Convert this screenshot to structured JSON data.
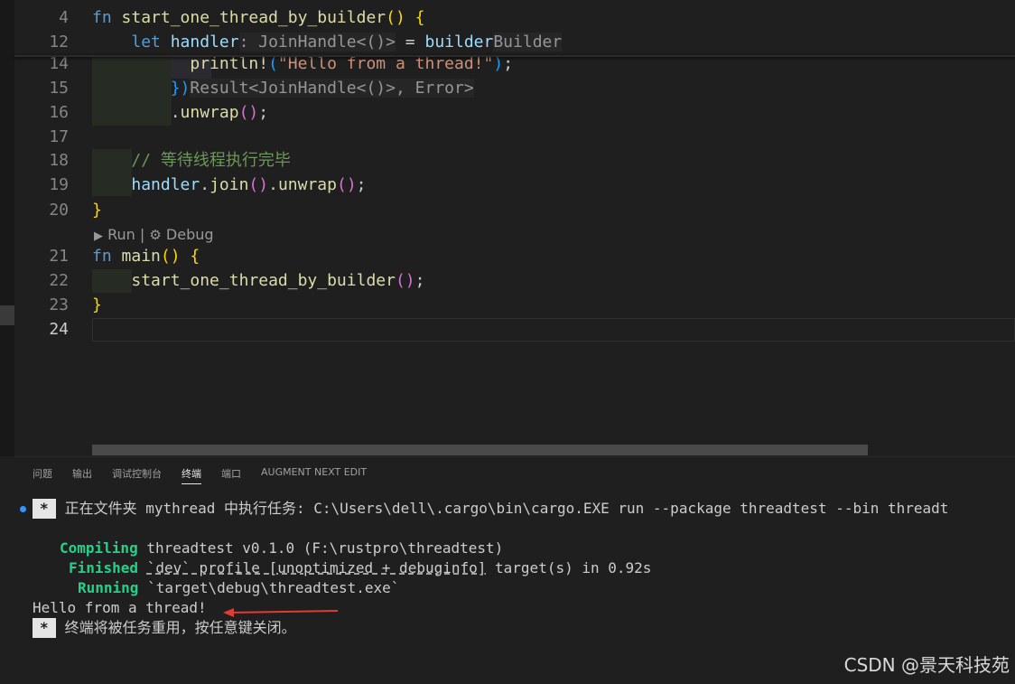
{
  "editor": {
    "lines": [
      {
        "n": "4",
        "segments": [
          [
            "kw",
            "fn "
          ],
          [
            "fn",
            "start_one_thread_by_builder"
          ],
          [
            "br1",
            "() {"
          ]
        ]
      },
      {
        "n": "12",
        "segments": [
          [
            "plain",
            "    "
          ],
          [
            "kw",
            "let "
          ],
          [
            "var",
            "handler"
          ],
          [
            "hint",
            ": JoinHandle<()>"
          ],
          [
            "plain",
            " = "
          ],
          [
            "var",
            "builder"
          ],
          [
            "hint",
            "Builder"
          ]
        ]
      },
      {
        "n": "14",
        "segments": [
          [
            "plain",
            "          "
          ],
          [
            "fn",
            "println!"
          ],
          [
            "br3",
            "("
          ],
          [
            "str",
            "\"Hello from a thread!\""
          ],
          [
            "br3",
            ")"
          ],
          [
            "plain",
            ";"
          ]
        ]
      },
      {
        "n": "15",
        "segments": [
          [
            "plain",
            "        "
          ],
          [
            "br3",
            "})"
          ],
          [
            "hint",
            "Result<JoinHandle<()>, Error>"
          ]
        ]
      },
      {
        "n": "16",
        "segments": [
          [
            "plain",
            "        ."
          ],
          [
            "fn",
            "unwrap"
          ],
          [
            "br2",
            "()"
          ],
          [
            "plain",
            ";"
          ]
        ]
      },
      {
        "n": "17",
        "segments": []
      },
      {
        "n": "18",
        "segments": [
          [
            "plain",
            "    "
          ],
          [
            "cmt",
            "// 等待线程执行完毕"
          ]
        ]
      },
      {
        "n": "19",
        "segments": [
          [
            "plain",
            "    "
          ],
          [
            "var",
            "handler"
          ],
          [
            "plain",
            "."
          ],
          [
            "fn",
            "join"
          ],
          [
            "br2",
            "()"
          ],
          [
            "plain",
            "."
          ],
          [
            "fn",
            "unwrap"
          ],
          [
            "br2",
            "()"
          ],
          [
            "plain",
            ";"
          ]
        ]
      },
      {
        "n": "20",
        "segments": [
          [
            "br1",
            "}"
          ]
        ]
      },
      {
        "n": "21",
        "segments": [
          [
            "kw",
            "fn "
          ],
          [
            "fn",
            "main"
          ],
          [
            "br1",
            "() {"
          ]
        ]
      },
      {
        "n": "22",
        "segments": [
          [
            "plain",
            "    "
          ],
          [
            "fn",
            "start_one_thread_by_builder"
          ],
          [
            "br2",
            "()"
          ],
          [
            "plain",
            ";"
          ]
        ]
      },
      {
        "n": "23",
        "segments": [
          [
            "br1",
            "}"
          ]
        ]
      },
      {
        "n": "24",
        "segments": []
      }
    ],
    "codelens_run": "Run",
    "codelens_sep": "|",
    "codelens_debug": "Debug",
    "run_icon": "play-icon",
    "debug_icon": "gear-icon"
  },
  "panel": {
    "tabs": [
      {
        "label": "问题",
        "active": false
      },
      {
        "label": "输出",
        "active": false
      },
      {
        "label": "调试控制台",
        "active": false
      },
      {
        "label": "终端",
        "active": true
      },
      {
        "label": "端口",
        "active": false
      },
      {
        "label": "AUGMENT NEXT EDIT",
        "active": false
      }
    ],
    "terminal": {
      "task_star": "*",
      "task_line": "正在文件夹 mythread 中执行任务: C:\\Users\\dell\\.cargo\\bin\\cargo.EXE run --package threadtest --bin threadt",
      "compiling_kw": "Compiling",
      "compiling_rest": " threadtest v0.1.0 (F:\\rustpro\\threadtest)",
      "finished_kw": "Finished",
      "finished_profile": "`dev` profile [unoptimized + debuginfo]",
      "finished_rest": " target(s) in 0.92s",
      "running_kw": "Running",
      "running_rest": " `target\\debug\\threadtest.exe`",
      "output": "Hello from a thread!",
      "reuse_star": "*",
      "reuse_line": "终端将被任务重用，按任意键关闭。"
    }
  },
  "watermark": "CSDN @景天科技苑",
  "colors": {
    "accent": "#3794ff",
    "arrow": "#e03c31",
    "terminal_green": "#23d18b"
  }
}
